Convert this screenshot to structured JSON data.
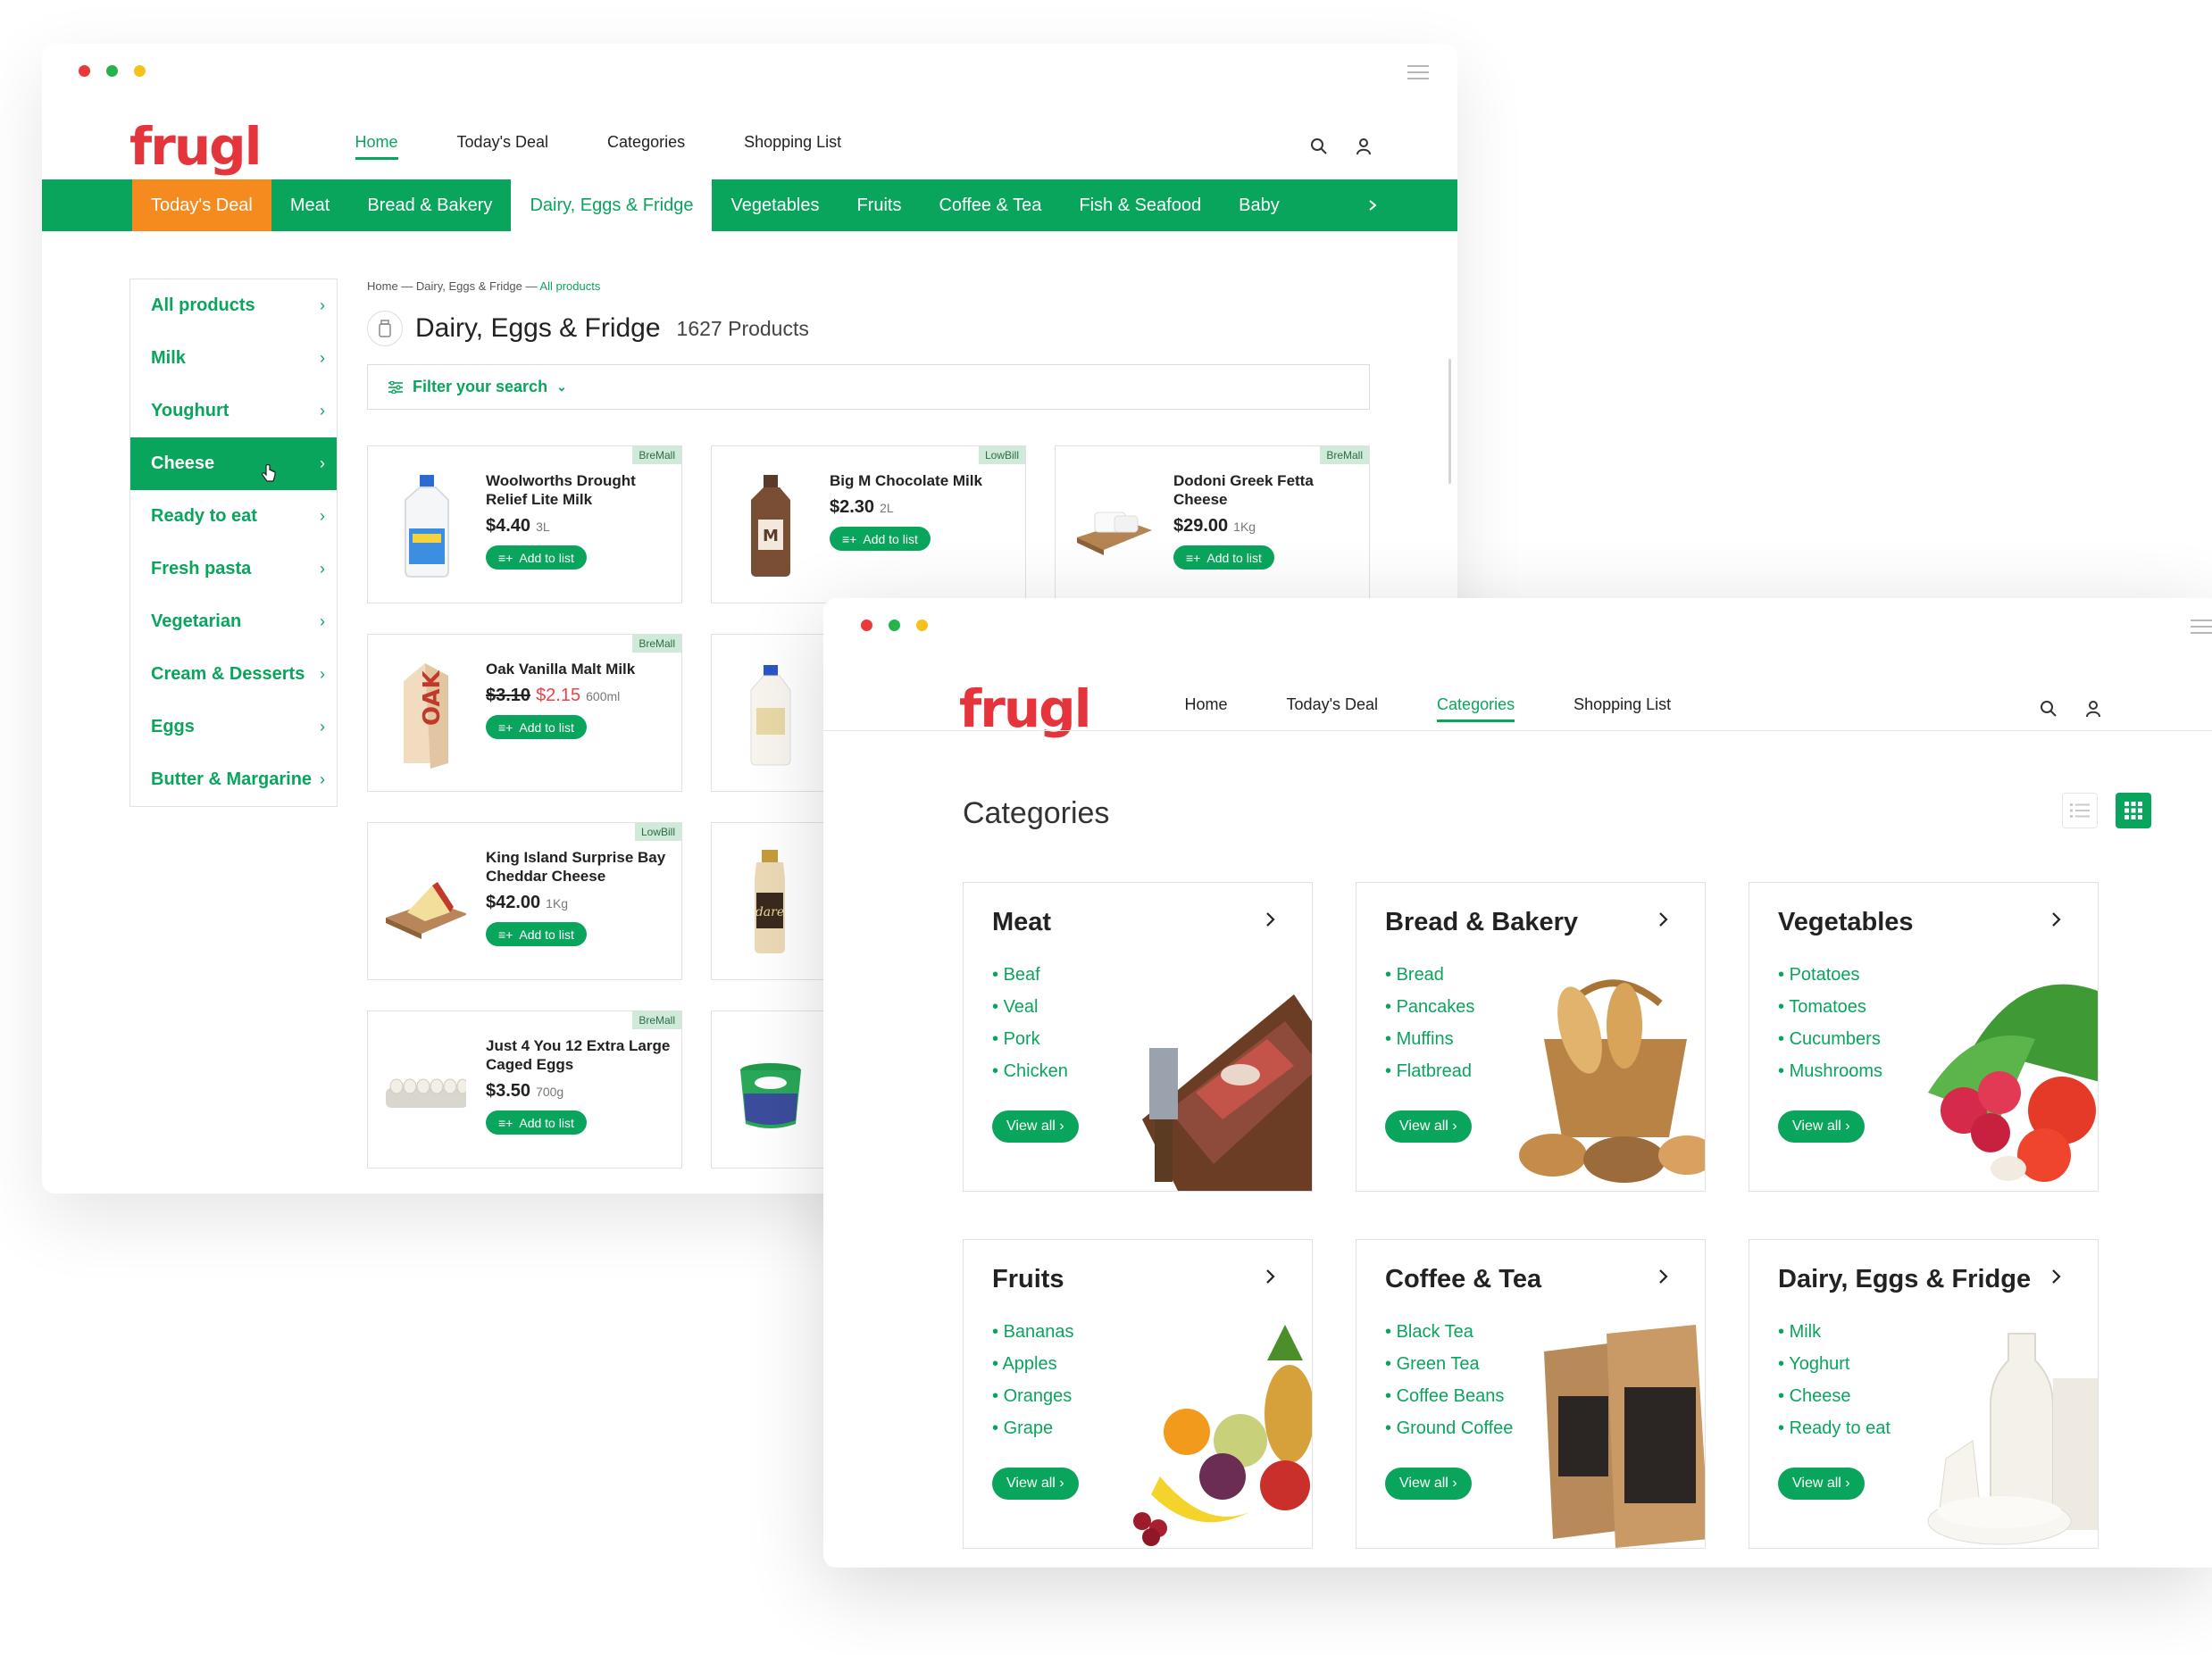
{
  "window1": {
    "logo": "frugl",
    "top_nav": [
      {
        "label": "Home",
        "active": true
      },
      {
        "label": "Today's Deal",
        "active": false
      },
      {
        "label": "Categories",
        "active": false
      },
      {
        "label": "Shopping List",
        "active": false
      }
    ],
    "category_bar": [
      {
        "label": "Today's Deal",
        "style": "deal"
      },
      {
        "label": "Meat",
        "style": ""
      },
      {
        "label": "Bread & Bakery",
        "style": ""
      },
      {
        "label": "Dairy, Eggs & Fridge",
        "style": "active"
      },
      {
        "label": "Vegetables",
        "style": ""
      },
      {
        "label": "Fruits",
        "style": ""
      },
      {
        "label": "Coffee & Tea",
        "style": ""
      },
      {
        "label": "Fish & Seafood",
        "style": ""
      },
      {
        "label": "Baby",
        "style": ""
      }
    ],
    "sidebar": [
      {
        "label": "All products",
        "active": false
      },
      {
        "label": "Milk",
        "active": false
      },
      {
        "label": "Youghurt",
        "active": false
      },
      {
        "label": "Cheese",
        "active": true
      },
      {
        "label": "Ready to eat",
        "active": false
      },
      {
        "label": "Fresh pasta",
        "active": false
      },
      {
        "label": "Vegetarian",
        "active": false
      },
      {
        "label": "Cream & Desserts",
        "active": false
      },
      {
        "label": "Eggs",
        "active": false
      },
      {
        "label": "Butter & Margarine",
        "active": false
      }
    ],
    "breadcrumb": {
      "home": "Home",
      "sep1": " — ",
      "category": "Dairy, Eggs & Fridge",
      "sep2": " — ",
      "current": "All products"
    },
    "page_title": "Dairy, Eggs & Fridge",
    "product_count": "1627 Products",
    "filter_label": "Filter your search",
    "add_label": "Add to list",
    "products": [
      {
        "tag": "BreMall",
        "name": "Woolworths Drought Relief Lite Milk",
        "price": "$4.40",
        "unit": "3L",
        "icon": "milk-jug-icon"
      },
      {
        "tag": "LowBill",
        "name": "Big M Chocolate Milk",
        "price": "$2.30",
        "unit": "2L",
        "icon": "chocolate-milk-icon"
      },
      {
        "tag": "BreMall",
        "name": "Dodoni Greek Fetta Cheese",
        "price": "$29.00",
        "unit": "1Kg",
        "icon": "feta-cheese-icon"
      },
      {
        "tag": "BreMall",
        "name": "Oak Vanilla Malt Milk",
        "old_price": "$3.10",
        "sale_price": "$2.15",
        "unit": "600ml",
        "icon": "oak-milk-carton-icon"
      },
      {
        "tag": "LowBill",
        "name": "King Island Surprise Bay Cheddar Cheese",
        "price": "$42.00",
        "unit": "1Kg",
        "icon": "cheddar-cheese-icon"
      },
      {
        "tag": "BreMall",
        "name": "Just 4 You 12 Extra Large Caged Eggs",
        "price": "$3.50",
        "unit": "700g",
        "icon": "egg-carton-icon"
      }
    ]
  },
  "window2": {
    "logo": "frugl",
    "top_nav": [
      {
        "label": "Home",
        "active": false
      },
      {
        "label": "Today's Deal",
        "active": false
      },
      {
        "label": "Categories",
        "active": true
      },
      {
        "label": "Shopping List",
        "active": false
      }
    ],
    "heading": "Categories",
    "view_all_label": "View all ›",
    "categories": [
      {
        "title": "Meat",
        "items": [
          "Beaf",
          "Veal",
          "Pork",
          "Chicken"
        ],
        "icon": "meat-illustration"
      },
      {
        "title": "Bread & Bakery",
        "items": [
          "Bread",
          "Pancakes",
          "Muffins",
          "Flatbread"
        ],
        "icon": "bread-basket-illustration"
      },
      {
        "title": "Vegetables",
        "items": [
          "Potatoes",
          "Tomatoes",
          "Cucumbers",
          "Mushrooms"
        ],
        "icon": "vegetables-illustration"
      },
      {
        "title": "Fruits",
        "items": [
          "Bananas",
          "Apples",
          "Oranges",
          "Grape"
        ],
        "icon": "fruits-illustration"
      },
      {
        "title": "Coffee & Tea",
        "items": [
          "Black Tea",
          "Green Tea",
          "Coffee Beans",
          "Ground Coffee"
        ],
        "icon": "coffee-bags-illustration"
      },
      {
        "title": "Dairy, Eggs & Fridge",
        "items": [
          "Milk",
          "Yoghurt",
          "Cheese",
          "Ready to eat"
        ],
        "icon": "dairy-illustration"
      }
    ]
  },
  "colors": {
    "brand_green": "#0aa55c",
    "deal_orange": "#f58a1f",
    "logo_red": "#e4353c",
    "sale_red": "#e84646"
  }
}
